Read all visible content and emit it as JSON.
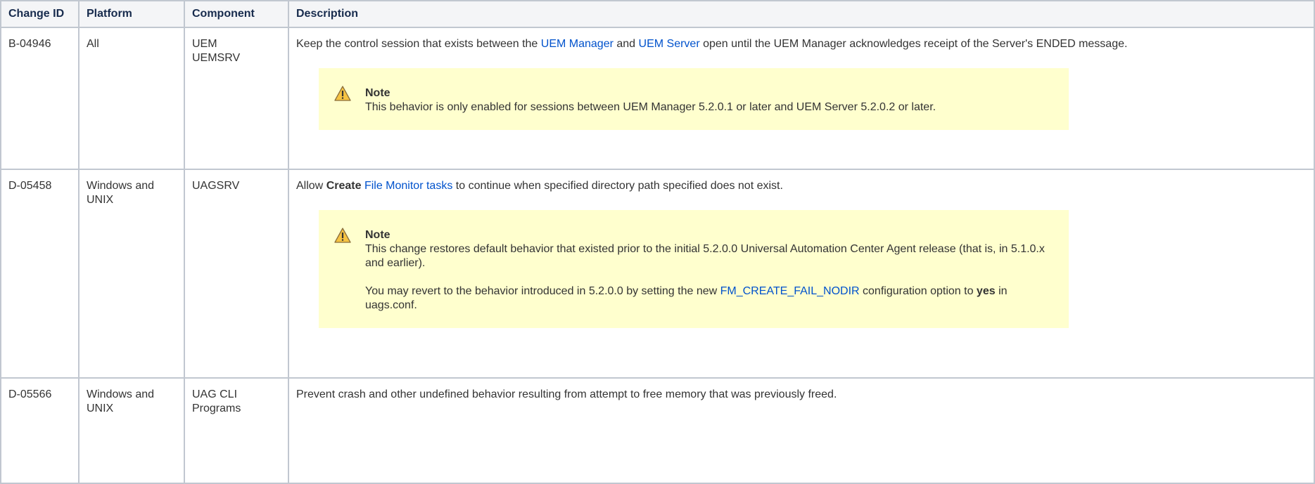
{
  "headers": [
    "Change ID",
    "Platform",
    "Component",
    "Description"
  ],
  "rows": [
    {
      "id": "B-04946",
      "platform": "All",
      "component_line1": "UEM",
      "component_line2": "UEMSRV",
      "desc": {
        "t1": "Keep the control session that exists between the ",
        "link1": "UEM Manager",
        "t2": " and ",
        "link2": "UEM Server",
        "t3": " open until the UEM Manager acknowledges receipt of the Server's ENDED message."
      },
      "note": {
        "title": "Note",
        "text": "This behavior is only enabled for sessions between UEM Manager 5.2.0.1 or later and UEM Server 5.2.0.2 or later."
      }
    },
    {
      "id": "D-05458",
      "platform": "Windows and UNIX",
      "component_line1": "UAGSRV",
      "desc": {
        "t1": "Allow ",
        "bold1": "Create",
        "t2": " ",
        "link1": "File Monitor tasks",
        "t3": " to continue when specified directory path specified does not exist."
      },
      "note": {
        "title": "Note",
        "text1": "This change restores default behavior that existed prior to the initial 5.2.0.0 Universal Automation Center Agent release (that is, in 5.1.0.x and earlier).",
        "text2a": "You may revert to the behavior introduced in 5.2.0.0 by setting the new ",
        "text2link": "FM_CREATE_FAIL_NODIR",
        "text2b": " configuration option to ",
        "text2bold": "yes",
        "text2c": " in uags.conf."
      }
    },
    {
      "id": "D-05566",
      "platform": "Windows and UNIX",
      "component_line1": "UAG CLI",
      "component_line2": "Programs",
      "desc": {
        "t1": "Prevent crash and other undefined behavior resulting from attempt to free memory that was previously freed."
      }
    }
  ],
  "colors": {
    "header_bg": "#f4f5f7",
    "header_text": "#172b4d",
    "link": "#0052cc",
    "note_bg": "#ffffce",
    "border": "#c1c7d0"
  },
  "icons": {
    "note": "warning-icon"
  }
}
